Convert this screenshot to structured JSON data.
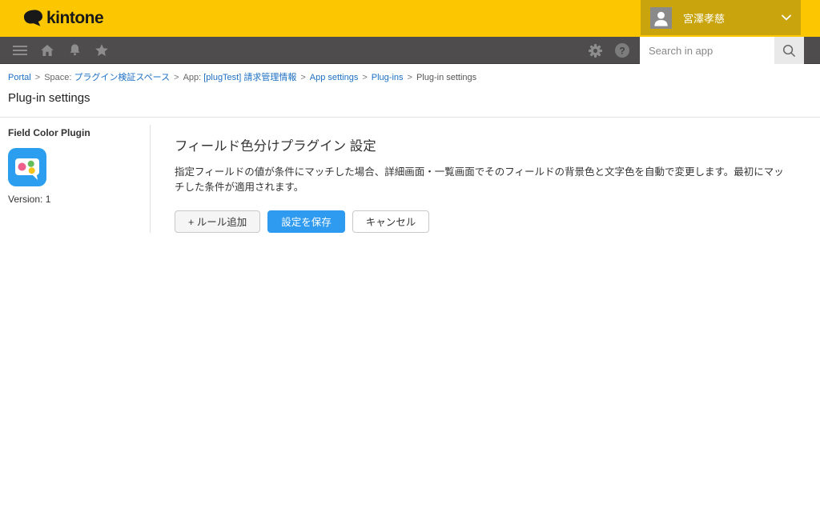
{
  "header": {
    "logo_text": "kintone",
    "user": {
      "name": "宮澤孝慈"
    }
  },
  "navbar": {
    "search": {
      "placeholder": "Search in app"
    }
  },
  "breadcrumb": {
    "separator": ">",
    "items": [
      {
        "label": "Portal",
        "type": "link"
      },
      {
        "prefix": "Space:",
        "label": "プラグイン検証スペース",
        "type": "link"
      },
      {
        "prefix": "App:",
        "label": "[plugTest] 請求管理情報",
        "type": "link"
      },
      {
        "label": "App settings",
        "type": "link"
      },
      {
        "label": "Plug-ins",
        "type": "link"
      },
      {
        "label": "Plug-in settings",
        "type": "current"
      }
    ]
  },
  "page": {
    "title": "Plug-in settings"
  },
  "sidebar": {
    "plugin_name": "Field Color Plugin",
    "version": "Version: 1"
  },
  "main": {
    "heading": "フィールド色分けプラグイン 設定",
    "description": "指定フィールドの値が条件にマッチした場合、詳細画面・一覧画面でそのフィールドの背景色と文字色を自動で変更します。最初にマッチした条件が適用されます。",
    "buttons": {
      "add_rule": "+ ルール追加",
      "save": "設定を保存",
      "cancel": "キャンセル"
    }
  },
  "colors": {
    "header_yellow": "#fdc700",
    "user_badge_yellow": "#c9a40d",
    "navbar_gray": "#4e4c4c",
    "link_blue": "#1d70c4",
    "primary_button_blue": "#2e9af0",
    "plugin_icon_blue": "#2c9ef0"
  }
}
